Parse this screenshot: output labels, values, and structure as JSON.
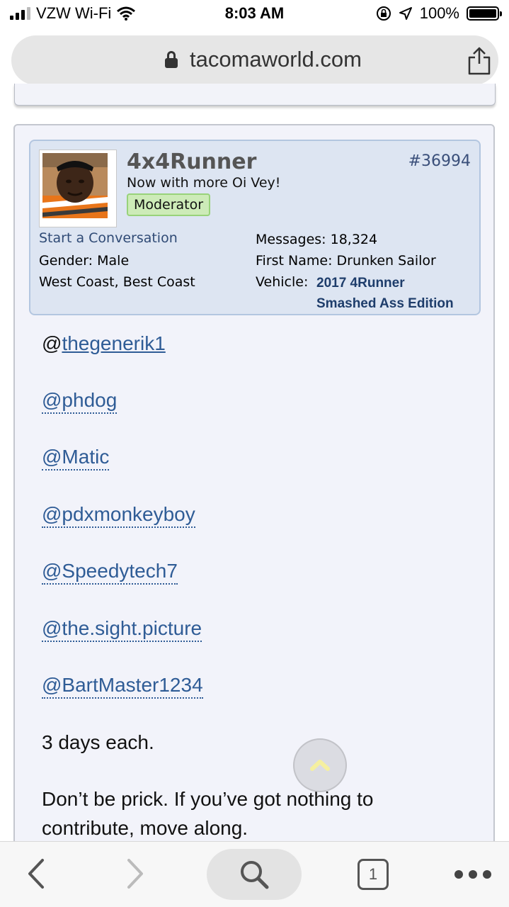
{
  "status_bar": {
    "carrier": "VZW Wi-Fi",
    "time": "8:03 AM",
    "battery": "100%"
  },
  "browser": {
    "url": "tacomaworld.com",
    "tab_count": "1"
  },
  "post": {
    "username": "4x4Runner",
    "user_title": "Now with more Oi Vey!",
    "badge": "Moderator",
    "post_number": "#36994",
    "start_conversation": "Start a Conversation",
    "gender": "Gender:  Male",
    "location": "West Coast, Best Coast",
    "messages": "Messages:  18,324",
    "first_name": "First Name:  Drunken Sailor",
    "vehicle_label": "Vehicle:",
    "vehicle_line1": "2017 4Runner",
    "vehicle_line2": "Smashed Ass Edition",
    "mentions": [
      "thegenerik1",
      "@phdog",
      "@Matic",
      "@pdxmonkeyboy",
      "@Speedytech7",
      "@the.sight.picture",
      "@BartMaster1234"
    ],
    "at_sign": "@",
    "text_1": "3 days each.",
    "text_2_line1": "Don’t be prick. If you’ve got nothing to",
    "text_2_line2": "contribute, move along."
  },
  "icons": [
    "signal-icon",
    "wifi-icon",
    "orientation-lock-icon",
    "location-arrow-icon",
    "battery-icon",
    "lock-icon",
    "share-icon",
    "scroll-top-icon",
    "back-icon",
    "forward-icon",
    "search-icon",
    "tabs-icon",
    "more-icon"
  ]
}
